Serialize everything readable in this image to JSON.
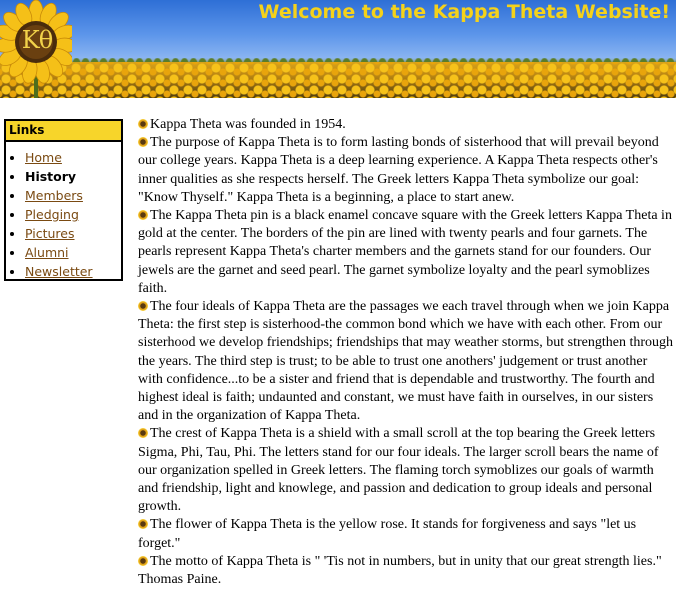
{
  "header": {
    "title": "Welcome to the Kappa Theta Website!",
    "logo_text": "Κθ"
  },
  "links": {
    "heading": "Links",
    "items": [
      {
        "label": "Home",
        "current": false
      },
      {
        "label": "History",
        "current": true
      },
      {
        "label": "Members",
        "current": false
      },
      {
        "label": "Pledging",
        "current": false
      },
      {
        "label": "Pictures",
        "current": false
      },
      {
        "label": "Alumni",
        "current": false
      },
      {
        "label": "Newsletter",
        "current": false
      }
    ]
  },
  "content": {
    "bullet_icon": "sunflower-bullet-icon",
    "paragraphs": [
      "Kappa Theta was founded in 1954.",
      "The purpose of Kappa Theta is to form lasting bonds of sisterhood that will prevail beyond our college years. Kappa Theta is a deep learning experience. A Kappa Theta respects other's inner qualities as she respects herself. The Greek letters Kappa Theta symbolize our goal: \"Know Thyself.\" Kappa Theta is a beginning, a place to start anew.",
      "The Kappa Theta pin is a black enamel concave square with the Greek letters Kappa Theta in gold at the center. The borders of the pin are lined with twenty pearls and four garnets. The pearls represent Kappa Theta's charter members and the garnets stand for our founders. Our jewels are the garnet and seed pearl. The garnet symbolize loyalty and the pearl symoblizes faith.",
      "The four ideals of Kappa Theta are the passages we each travel through when we join Kappa Theta: the first step is sisterhood-the common bond which we have with each other. From our sisterhood we develop friendships; friendships that may weather storms, but strengthen through the years. The third step is trust; to be able to trust one anothers' judgement or trust another with confidence...to be a sister and friend that is dependable and trustworthy. The fourth and highest ideal is faith; undaunted and constant, we must have faith in ourselves, in our sisters and in the organization of Kappa Theta.",
      "The crest of Kappa Theta is a shield with a small scroll at the top bearing the Greek letters Sigma, Phi, Tau, Phi. The letters stand for our four ideals. The larger scroll bears the name of our organization spelled in Greek letters. The flaming torch symoblizes our goals of warmth and friendship, light and knowlege, and passion and dedication to group ideals and personal growth.",
      "The flower of Kappa Theta is the yellow rose. It stands for forgiveness and says \"let us forget.\"",
      "The motto of Kappa Theta is \" 'Tis not in numbers, but in unity that our great strength lies.\" Thomas Paine."
    ]
  },
  "colors": {
    "title_yellow": "#f5d21a",
    "links_header_bg": "#f7d52a",
    "link_color": "#7a4a12",
    "sky_blue": "#2e6fd6"
  }
}
